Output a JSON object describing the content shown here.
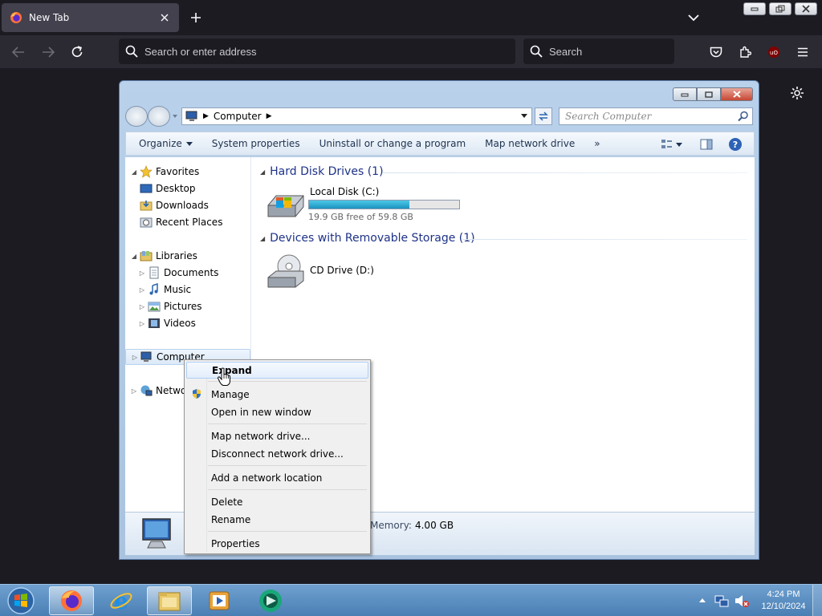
{
  "browser": {
    "tab_title": "New Tab",
    "urlbar_placeholder": "Search or enter address",
    "searchbar_placeholder": "Search"
  },
  "explorer": {
    "address_crumbs": [
      "Computer"
    ],
    "search_placeholder": "Search Computer",
    "toolbar": {
      "organize": "Organize",
      "system_properties": "System properties",
      "uninstall": "Uninstall or change a program",
      "map_drive": "Map network drive",
      "more": "»"
    },
    "nav": {
      "favorites": "Favorites",
      "desktop": "Desktop",
      "downloads": "Downloads",
      "recent_places": "Recent Places",
      "libraries": "Libraries",
      "documents": "Documents",
      "music": "Music",
      "pictures": "Pictures",
      "videos": "Videos",
      "computer": "Computer",
      "network": "Network"
    },
    "groups": [
      {
        "title": "Hard Disk Drives (1)"
      },
      {
        "title": "Devices with Removable Storage (1)"
      }
    ],
    "drives": [
      {
        "label": "Local Disk (C:)",
        "free_text": "19.9 GB free of 59.8 GB",
        "used_fraction": 0.667
      },
      {
        "label": "CD Drive (D:)"
      }
    ],
    "details": {
      "memory_label": "Memory:",
      "memory_value": "4.00 GB"
    }
  },
  "context_menu": {
    "items": [
      {
        "label": "Expand",
        "bold": true,
        "highlighted": true
      },
      {
        "label": "Manage",
        "icon": "shield-icon"
      },
      {
        "label": "Open in new window"
      },
      {
        "label": "Map network drive..."
      },
      {
        "label": "Disconnect network drive..."
      },
      {
        "label": "Add a network location"
      },
      {
        "label": "Delete"
      },
      {
        "label": "Rename"
      },
      {
        "label": "Properties"
      }
    ]
  },
  "taskbar": {
    "apps": [
      "firefox-icon",
      "internet-explorer-icon",
      "file-explorer-icon",
      "media-player-icon",
      "app-icon"
    ],
    "time": "4:24 PM",
    "date": "12/10/2024"
  }
}
